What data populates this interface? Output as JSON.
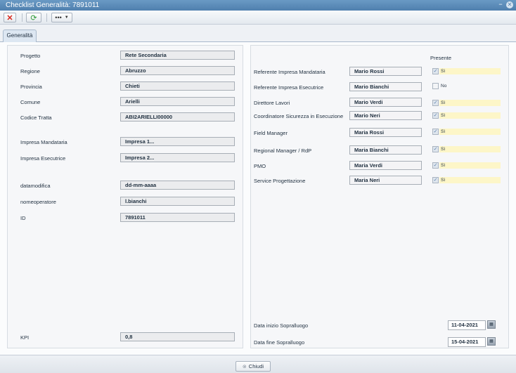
{
  "window": {
    "title": "Checklist Generalità: 7891011"
  },
  "tabs": [
    {
      "label": "Generalità"
    }
  ],
  "left": {
    "fields": [
      {
        "label": "Progetto",
        "value": "Rete Secondaria"
      },
      {
        "label": "Regione",
        "value": "Abruzzo"
      },
      {
        "label": "Provincia",
        "value": "Chieti"
      },
      {
        "label": "Comune",
        "value": "Arielli"
      },
      {
        "label": "Codice Tratta",
        "value": "ABI2ARIELLI00000"
      },
      {
        "label": "Impresa Mandataria",
        "value": "Impresa 1..."
      },
      {
        "label": "Impresa Esecutrice",
        "value": "Impresa 2..."
      },
      {
        "label": "datamodifica",
        "value": "dd-mm-aaaa"
      },
      {
        "label": "nomeoperatore",
        "value": "l.bianchi"
      },
      {
        "label": "ID",
        "value": "7891011"
      },
      {
        "label": "KPI",
        "value": "0,8"
      }
    ]
  },
  "right": {
    "presente_header": "Presente",
    "rows": [
      {
        "label": "Referente Impresa Mandataria",
        "value": "Mario Rossi",
        "checked": true,
        "check_label": "Sì"
      },
      {
        "label": "Referente Impresa Esecutrice",
        "value": "Mario Bianchi",
        "checked": false,
        "check_label": "No"
      },
      {
        "label": "Direttore Lavori",
        "value": "Mario Verdi",
        "checked": true,
        "check_label": "Sì"
      },
      {
        "label": "Coordinatore Sicurezza in Esecuzione",
        "value": "Mario Neri",
        "checked": true,
        "check_label": "Sì"
      },
      {
        "label": "Field Manager",
        "value": "Maria Rossi",
        "checked": true,
        "check_label": "Sì"
      },
      {
        "label": "Regional Manager / RdP",
        "value": "Maria Bianchi",
        "checked": true,
        "check_label": "Sì"
      },
      {
        "label": "PMO",
        "value": "Maria Verdi",
        "checked": true,
        "check_label": "Sì"
      },
      {
        "label": "Service Progettazione",
        "value": "Maria Neri",
        "checked": true,
        "check_label": "Sì"
      }
    ],
    "dates": [
      {
        "label": "Data inizio Sopralluogo",
        "value": "11-04-2021"
      },
      {
        "label": "Data fine Sopralluogo",
        "value": "15-04-2021"
      }
    ]
  },
  "footer": {
    "close_label": "Chiudi"
  },
  "icons": {
    "close": "close-icon",
    "refresh": "refresh-icon",
    "more": "more-icon",
    "calendar": "calendar-icon"
  },
  "colors": {
    "title_bar": "#5a8aba",
    "check_yes_bg": "#fdf6c8",
    "close_red": "#d8261c",
    "refresh_green": "#2d9a37"
  }
}
